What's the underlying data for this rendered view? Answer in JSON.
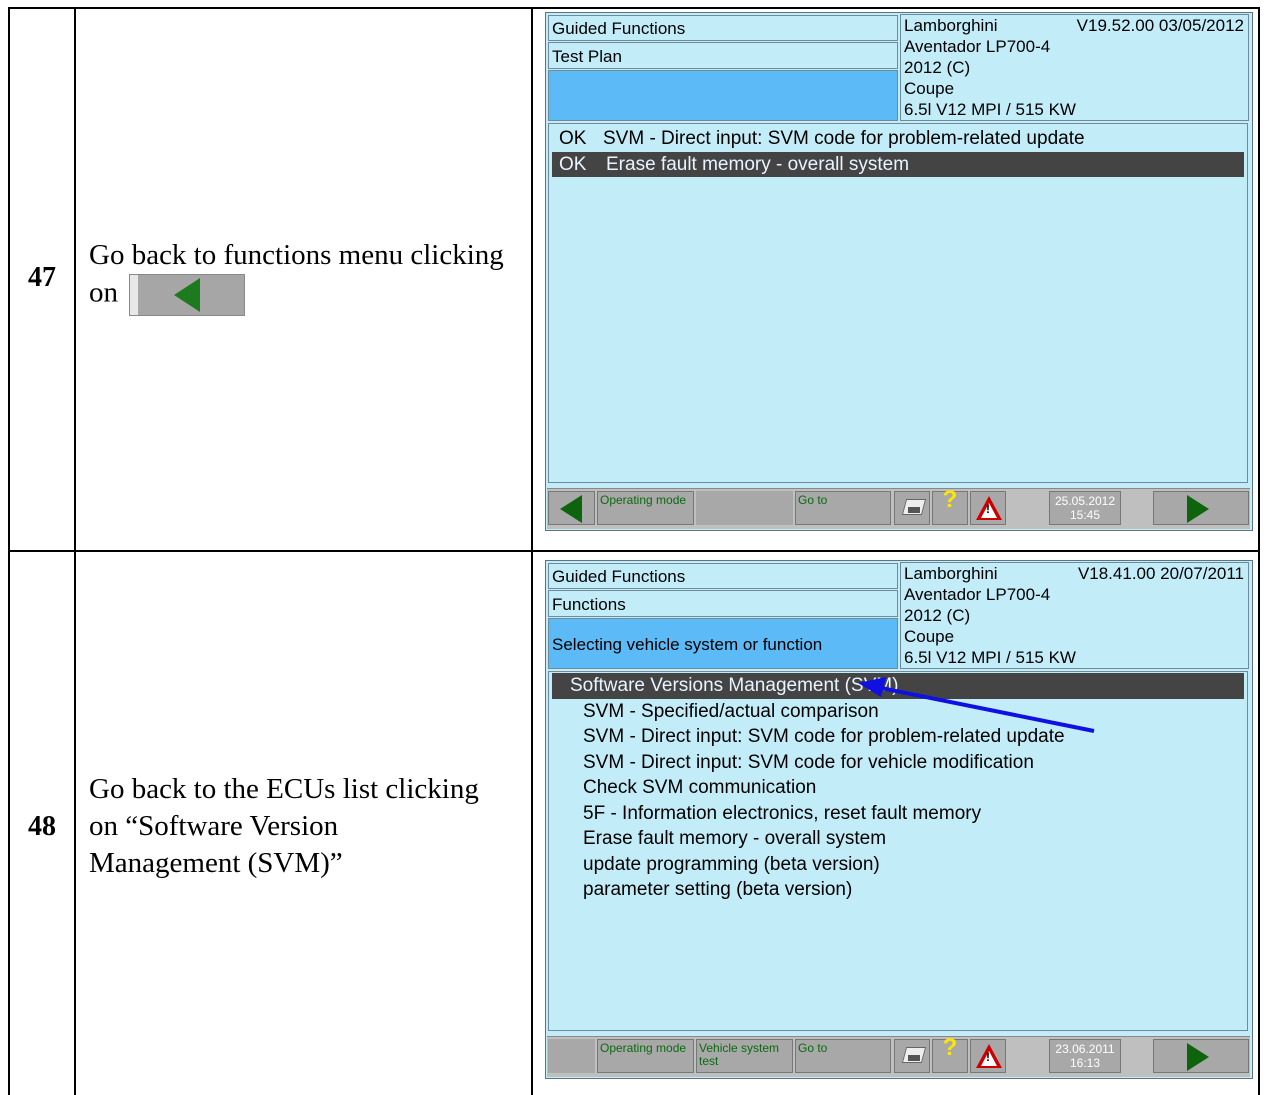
{
  "steps": [
    {
      "number": "47",
      "text_before": "Go back to functions menu clicking on",
      "screen": {
        "header": {
          "guided": "Guided Functions",
          "plan": "Test Plan",
          "selection": ""
        },
        "vehicle": {
          "make": "Lamborghini",
          "version": "V19.52.00 03/05/2012",
          "model": "Aventador LP700-4",
          "year": "2012 (C)",
          "body": "Coupe",
          "engine": "6.5l V12 MPI / 515 KW"
        },
        "list": [
          {
            "status": "OK",
            "label": "SVM - Direct input: SVM code for problem-related update"
          },
          {
            "status": "OK",
            "label": "Erase fault memory - overall system"
          }
        ],
        "toolbar": {
          "operating_mode": "Operating mode",
          "vehicle_system": "",
          "go_to": "Go to",
          "date": "25.05.2012",
          "time": "15:45",
          "help": "?",
          "warning": "!"
        }
      }
    },
    {
      "number": "48",
      "text": "Go back to the ECUs list clicking on “Software Version Management (SVM)”",
      "screen": {
        "header": {
          "guided": "Guided Functions",
          "plan": "Functions",
          "selection": "Selecting vehicle system or function"
        },
        "vehicle": {
          "make": "Lamborghini",
          "version": "V18.41.00 20/07/2011",
          "model": "Aventador LP700-4",
          "year": "2012 (C)",
          "body": "Coupe",
          "engine": "6.5l V12 MPI / 515 KW"
        },
        "list": [
          "Software Versions Management (SVM)",
          "SVM - Specified/actual comparison",
          "SVM - Direct input: SVM code for problem-related update",
          "SVM - Direct input: SVM code for vehicle modification",
          "Check SVM communication",
          "5F - Information electronics, reset fault memory",
          "Erase fault memory - overall system",
          "update programming (beta version)",
          "parameter setting (beta version)"
        ],
        "toolbar": {
          "operating_mode": "Operating mode",
          "vehicle_system": "Vehicle system test",
          "go_to": "Go to",
          "date": "23.06.2011",
          "time": "16:13",
          "help": "?",
          "warning": "!"
        }
      }
    }
  ],
  "colors": {
    "screen_bg": "#c3ecf9",
    "selected_bg": "#5cbaf6",
    "row_highlight": "#444444",
    "arrow": "#1010e0",
    "nav_green": "#0d640d"
  },
  "icons": [
    "back-arrow-icon",
    "forward-arrow-icon",
    "printer-icon",
    "help-icon",
    "warning-icon"
  ]
}
